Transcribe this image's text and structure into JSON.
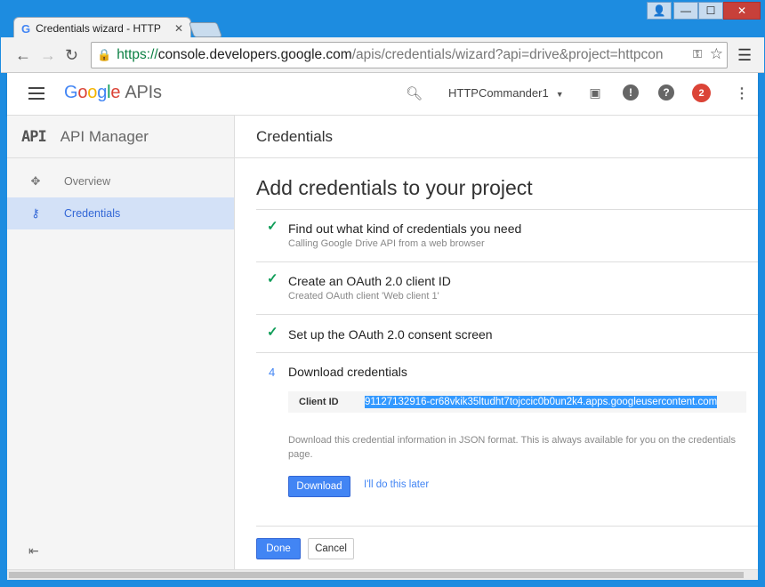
{
  "browser": {
    "tab_title": "Credentials wizard - HTTP",
    "tab_icon": "google-g-icon",
    "url_https": "https://",
    "url_host": "console.developers.google.com",
    "url_path": "/apis/credentials/wizard?api=drive&project=httpcon",
    "window_buttons": [
      "minimize",
      "maximize",
      "close"
    ]
  },
  "appbar": {
    "logo_google": "Google",
    "logo_apis": "APIs",
    "project_name": "HTTPCommander1",
    "notification_count": "2"
  },
  "sidebar": {
    "logo_text": "API",
    "title": "API Manager",
    "items": [
      {
        "label": "Overview",
        "icon": "overview-icon",
        "active": false
      },
      {
        "label": "Credentials",
        "icon": "key-icon",
        "active": true
      }
    ]
  },
  "main": {
    "header": "Credentials",
    "page_title": "Add credentials to your project",
    "steps": [
      {
        "title": "Find out what kind of credentials you need",
        "subtitle": "Calling Google Drive API from a web browser",
        "done": true
      },
      {
        "title": "Create an OAuth 2.0 client ID",
        "subtitle": "Created OAuth client 'Web client 1'",
        "done": true
      },
      {
        "title": "Set up the OAuth 2.0 consent screen",
        "subtitle": "",
        "done": true
      },
      {
        "number": "4",
        "title": "Download credentials",
        "done": false
      }
    ],
    "client_id_label": "Client ID",
    "client_id_value": "91127132916-cr68vkik35ltudht7tojccic0b0un2k4.apps.googleusercontent.com",
    "download_note": "Download this credential information in JSON format. This is always available for you on the credentials page.",
    "download_button": "Download",
    "later_link": "I'll do this later",
    "done_button": "Done",
    "cancel_button": "Cancel"
  },
  "colors": {
    "accent": "#4285f4",
    "check": "#0f9d58",
    "badge": "#db4437",
    "sidebar_active_bg": "#d3e1f7"
  }
}
